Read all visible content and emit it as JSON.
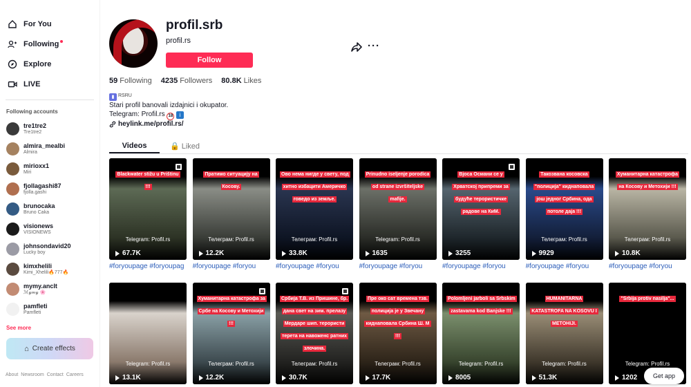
{
  "nav": {
    "items": [
      {
        "label": "For You",
        "icon": "home-icon"
      },
      {
        "label": "Following",
        "icon": "following-icon",
        "dot": true
      },
      {
        "label": "Explore",
        "icon": "compass-icon"
      },
      {
        "label": "LIVE",
        "icon": "live-icon"
      }
    ]
  },
  "following_accounts": {
    "title": "Following accounts",
    "accounts": [
      {
        "username": "tre1tre2",
        "name": "Tre1tre2",
        "avatar_color": "#3a3a3a"
      },
      {
        "username": "almira_mealbi",
        "name": "Almira",
        "avatar_color": "#a58260"
      },
      {
        "username": "mirioxx1",
        "name": "Miri",
        "avatar_color": "#7a5b3c"
      },
      {
        "username": "fjollagashi87",
        "name": "fjolla.gashi",
        "avatar_color": "#b06f4f"
      },
      {
        "username": "brunocaka",
        "name": "Bruno Caka",
        "avatar_color": "#345b84"
      },
      {
        "username": "visionews",
        "name": "VISIONEWS",
        "avatar_color": "#1a1a1a"
      },
      {
        "username": "johnsondavid20",
        "name": "Lucky boy",
        "avatar_color": "#9b9ba5"
      },
      {
        "username": "kimxhelili",
        "name": "Kimi_Xhelili🔥777🔥",
        "avatar_color": "#5a4a3f"
      },
      {
        "username": "mymy.anclt",
        "name": "ℳ𝓎𝓂𝓎 🌸",
        "avatar_color": "#c28b73"
      },
      {
        "username": "pamfleti",
        "name": "Pamfleti",
        "avatar_color": "#f1f1f1"
      }
    ],
    "see_more": "See more"
  },
  "create_effects": "Create effects",
  "footer_links": [
    "About",
    "Newsroom",
    "Contact",
    "Careers"
  ],
  "profile": {
    "username": "profil.srb",
    "display_name": "profil.rs",
    "follow_label": "Follow",
    "stats": {
      "following": "59",
      "following_label": "Following",
      "followers": "4235",
      "followers_label": "Followers",
      "likes": "80.8K",
      "likes_label": "Likes"
    },
    "bio_tag": "RSRU",
    "bio_line1": "Stari profil banovali izdajnici i okupator.",
    "bio_line2": "Telegram: Profil.rs",
    "bio_link": "heylink.me/profil.rs/"
  },
  "tabs": {
    "videos": "Videos",
    "liked": "Liked"
  },
  "videos": [
    {
      "caption": "Blackwater stižu u Prištinu !!!",
      "views": "67.7K",
      "tg": "Telegram: Profil.rs",
      "hashtag": "#foryoupage #foryoupag",
      "pinned": true,
      "colors": [
        "#5d6a55",
        "#2d3325"
      ]
    },
    {
      "caption": "Пратимо ситуацију на Косову.",
      "views": "12.2K",
      "tg": "Телеграм: Profil.rs",
      "hashtag": "#foryoupage #foryou",
      "pinned": false,
      "colors": [
        "#8a8d86",
        "#3a3d38"
      ]
    },
    {
      "caption": "Ово нема нигде у свету, под хитно избацити Америчко говедо из земље.",
      "views": "33.8K",
      "tg": "Телеграм: Profil.rs",
      "hashtag": "#foryoupage #foryou",
      "pinned": false,
      "colors": [
        "#2a3550",
        "#0e1524"
      ]
    },
    {
      "caption": "Prinudno iseljenje porodica od strane izvršiteljske mafije.",
      "views": "1635",
      "tg": "Telegram: Profil.rs",
      "hashtag": "#foryoupage #foryou",
      "pinned": false,
      "colors": [
        "#6c7068",
        "#2b2d28"
      ]
    },
    {
      "caption": "Вјоса Османи се у Хрватској припреми за будуће терористичке радове на КиМ.",
      "views": "3255",
      "tg": "",
      "hashtag": "#foryoupage #foryou",
      "pinned": true,
      "colors": [
        "#55646e",
        "#1f272c"
      ]
    },
    {
      "caption": "Такозвана косовска \"полиција\" киднаповала још једног Србина, ода потоле даја !!!",
      "views": "9929",
      "tg": "Телеграм: Profil.rs",
      "hashtag": "#foryoupage #foryou",
      "pinned": false,
      "colors": [
        "#2a4a8a",
        "#131f3a"
      ]
    },
    {
      "caption": "Хуманитарна катастрофа на Косову и Метохији !!!",
      "views": "10.8K",
      "tg": "Телеграм: Profil.rs",
      "hashtag": "#foryoupage #foryou",
      "pinned": false,
      "colors": [
        "#b9b5a4",
        "#5b5a4e"
      ]
    },
    {
      "caption": "",
      "views": "13.1K",
      "tg": "Telegram: Profil.rs",
      "hashtag": "",
      "pinned": false,
      "colors": [
        "#d9d3cc",
        "#8b7a6d"
      ]
    },
    {
      "caption": "Хуманитарна катастрофа за Србе на Косову и Метохији !!!",
      "views": "12.2K",
      "tg": "Телеграм: Profil.rs",
      "hashtag": "",
      "pinned": true,
      "colors": [
        "#8aa0a6",
        "#3d4a4f"
      ]
    },
    {
      "caption": "Србија Т.В. из Пришине, бр. дана свет на зим. прелазу Мердаре шип. терористи терета на навоженс ратних злочина.",
      "views": "30.7K",
      "tg": "Телеграм: Profil.rs",
      "hashtag": "",
      "pinned": true,
      "colors": [
        "#5a5a55",
        "#222220"
      ]
    },
    {
      "caption": "Пре око сат времена тзв. полиција је у Звечану киднаповала Србина Ш. М !!!",
      "views": "17.7K",
      "tg": "Телеграм: Profil.rs",
      "hashtag": "",
      "pinned": false,
      "colors": [
        "#6f5a44",
        "#2d2419"
      ]
    },
    {
      "caption": "Polomljeni jarboli sa Srbskim zastavama kod Banjske !!!",
      "views": "8005",
      "tg": "Telegram: Profil.rs",
      "hashtag": "",
      "pinned": false,
      "colors": [
        "#7b8f6d",
        "#38452e"
      ]
    },
    {
      "caption": "HUMANITARNA KATASTROFA NA KOSOVU I METOHIJI.",
      "views": "51.3K",
      "tg": "Telegram: Profil.rs",
      "hashtag": "",
      "pinned": false,
      "colors": [
        "#9a8d76",
        "#3f382c"
      ]
    },
    {
      "caption": "\"Srbija protiv nasilja\"...",
      "views": "1202",
      "tg": "Telegram: Profil.rs",
      "hashtag": "",
      "pinned": false,
      "colors": [
        "#000000",
        "#000000"
      ]
    }
  ],
  "get_app": "Get app"
}
